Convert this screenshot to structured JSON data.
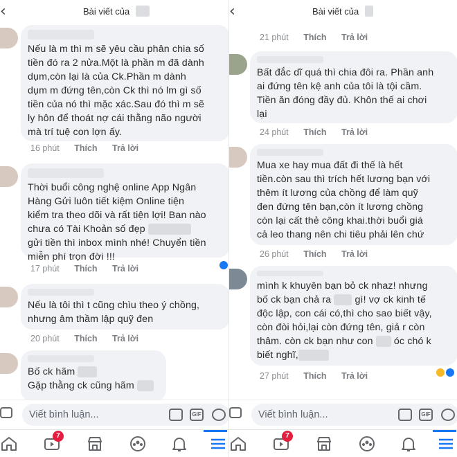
{
  "left": {
    "header": {
      "back_glyph": "‹",
      "title": "Bài viết của"
    },
    "comments": [
      {
        "text": "Nếu là m thì m sẽ yêu cầu phân chia số\ntiền đó ra 2 nửa.Một là phần m đã dành\ndụm,còn lại là của Ck.Phần m dành\ndụm m đứng tên,còn Ck thì nó lm gì số\ntiền của nó thì mặc xác.Sau đó thì m sẽ\nly hôn để thoát nợ cái thằng não người\nmà trí tuệ con lợn ấy.",
        "time": "16 phút",
        "like": "Thích",
        "reply": "Trả lời"
      },
      {
        "text": "Thời buổi công nghệ online App Ngân\nHàng Gửi luôn tiết kiệm Online tiện\nkiểm tra theo dõi và rất tiện lợi! Ban nào\nchưa có Tài Khoản số đẹp",
        "text_b": "gửi tiền thì inbox mình nhé! Chuyển tiền\nmiễn phí trọn đời !!!",
        "time": "17 phút",
        "like": "Thích",
        "reply": "Trả lời"
      },
      {
        "text": "Nếu là tôi thì t cũng chìu theo ý chồng,\nnhưng âm thầm lập quỹ đen",
        "time": "20 phút",
        "like": "Thích",
        "reply": "Trả lời"
      },
      {
        "text_a": "Bố ck hãm",
        "text_b": "Gặp thằng ck cũng hãm"
      }
    ],
    "composer": {
      "placeholder": "Viết bình luận...",
      "gif": "GIF"
    },
    "tabs": {
      "badge": "7"
    }
  },
  "right": {
    "header": {
      "back_glyph": "‹",
      "title": "Bài viết của"
    },
    "top_meta": {
      "time": "21 phút",
      "like": "Thích",
      "reply": "Trả lời"
    },
    "comments": [
      {
        "text": "Bất đắc dĩ quá thì chia đôi ra. Phần anh\nai đứng tên kệ anh của tôi là tội cầm.\nTiền ăn đóng đầy đủ. Khôn thế ai chơi\nlại",
        "time": "24 phút",
        "like": "Thích",
        "reply": "Trả lời"
      },
      {
        "text": "Mua xe hay mua đất đi thế là hết\ntiền.còn sau thì trích hết lương bạn với\nthêm ít lương của chồng để làm quỹ\nđen đứng tên bạn,còn ít lương chồng\ncòn lại cất thẻ công khai.thời buổi giá\ncả leo thang nên chi tiêu phải lên chứ",
        "time": "26 phút",
        "like": "Thích",
        "reply": "Trả lời"
      },
      {
        "l1": "mình k khuyên bạn bỏ ck nhaz! nhưng",
        "l2a": "bố ck bạn chả ra",
        "l2b": "gì! vợ ck kinh tế",
        "l3": "độc lập, con cái có,thì cho sao biết vậy,",
        "l4": "còn đòi hỏi,lại còn đứng tên, giả r còn",
        "l5a": "thâm. còn ck bạn như con",
        "l5b": "óc chó k",
        "l6a": "biết nghĩ,",
        "time": "27 phút",
        "like": "Thích",
        "reply": "Trả lời"
      }
    ],
    "composer": {
      "placeholder": "Viết bình luận...",
      "gif": "GIF"
    },
    "tabs": {
      "badge": "7"
    }
  }
}
